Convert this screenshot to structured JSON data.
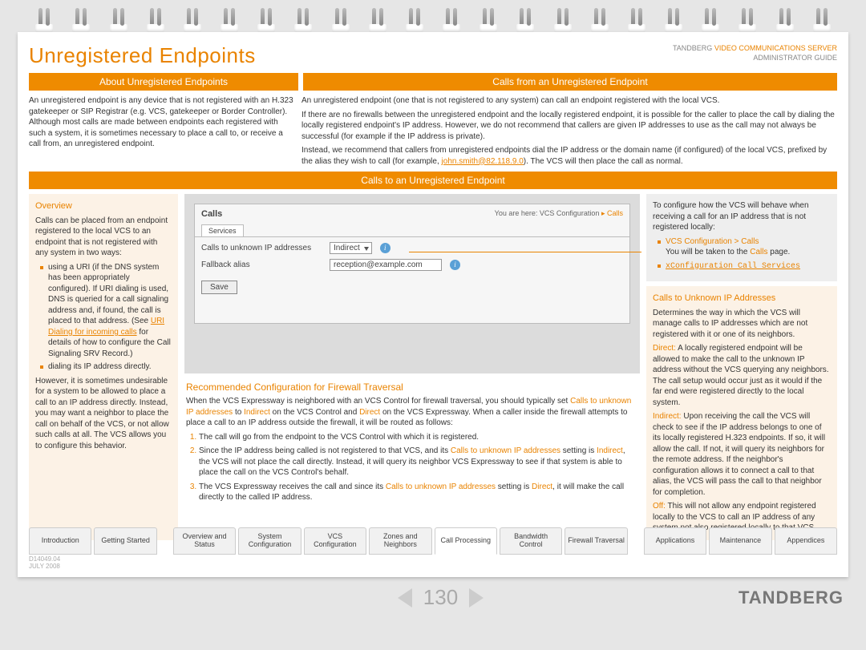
{
  "brand": {
    "company": "TANDBERG",
    "product": "VIDEO COMMUNICATIONS SERVER",
    "subtitle": "ADMINISTRATOR GUIDE",
    "logo": "TANDBERG"
  },
  "pageTitle": "Unregistered Endpoints",
  "bands": {
    "about": "About Unregistered Endpoints",
    "callsFrom": "Calls from an Unregistered Endpoint",
    "callsTo": "Calls to an Unregistered Endpoint"
  },
  "about": {
    "p1": "An unregistered endpoint is any device that is not registered with an H.323 gatekeeper or SIP Registrar (e.g. VCS, gatekeeper or Border Controller).   Although most calls are made between endpoints each registered with such a system, it is sometimes necessary to place a call to, or receive a call from, an unregistered endpoint."
  },
  "callsFrom": {
    "p1": "An unregistered endpoint (one that is not registered to any system) can call an endpoint registered with the local VCS.",
    "p2": "If there are no firewalls between the unregistered endpoint and the locally registered endpoint, it is possible for the caller to place the call by dialing the locally registered endpoint's IP address. However, we do not recommend that callers are given IP addresses to use as the call may not always be successful (for example if the IP address is private).",
    "p3a": "Instead, we recommend that callers from unregistered endpoints dial the IP address or the domain name (if configured) of the local VCS, prefixed by the alias they wish to call (for example, ",
    "p3link": "john.smith@82.118.9.0",
    "p3b": ").  The VCS will then place the call as normal."
  },
  "overview": {
    "title": "Overview",
    "intro": "Calls can be placed from an endpoint registered to the local VCS to an endpoint that is not registered with any system in two ways:",
    "b1a": "using a URI (if the DNS system has been appropriately configured). If URI dialing is used, DNS is queried for a call signaling address and, if found, the call is placed to that address. (See ",
    "b1link": "URI Dialing for incoming calls",
    "b1b": " for details of how to configure the Call Signaling SRV Record.)",
    "b2": "dialing its IP address directly.",
    "tail": "However, it is sometimes undesirable for a system to be allowed to place a call to an IP address directly. Instead, you may want a neighbor to place the call on behalf of the VCS, or not allow such calls at all.  The VCS allows you to configure this behavior."
  },
  "screenshot": {
    "panelTitle": "Calls",
    "crumbPrefix": "You are here: VCS Configuration",
    "crumbEnd": "Calls",
    "tab": "Services",
    "row1": {
      "label": "Calls to unknown IP addresses",
      "value": "Indirect"
    },
    "row2": {
      "label": "Fallback alias",
      "value": "reception@example.com"
    },
    "save": "Save"
  },
  "reco": {
    "title": "Recommended Configuration for Firewall Traversal",
    "p_a": "When the VCS Expressway is neighbored with an VCS Control for firewall traversal, you should typically set ",
    "p_l1": "Calls to unknown IP addresses",
    "p_b": " to ",
    "p_l2": "Indirect",
    "p_c": " on the VCS Control and ",
    "p_l3": "Direct",
    "p_d": " on the VCS Expressway. When a caller inside the firewall attempts to place a call to an IP address outside the firewall, it will be routed as follows:",
    "li1": "The call will go from the endpoint to the VCS Control with which it is registered.",
    "li2a": "Since the IP address being called is not registered to that VCS, and its ",
    "li2l1": "Calls to unknown IP addresses",
    "li2b": " setting is ",
    "li2l2": "Indirect",
    "li2c": ", the VCS will not place the call directly.  Instead, it will query its neighbor VCS Expressway to see if that system is able to place the call on the VCS Control's behalf.",
    "li3a": "The VCS Expressway receives the call and since its ",
    "li3l1": "Calls to unknown IP addresses",
    "li3b": " setting is ",
    "li3l2": "Direct",
    "li3c": ", it will make the call directly to the called IP address."
  },
  "configure": {
    "intro": "To configure how the VCS will behave when receiving a call for an IP address that is not registered locally:",
    "b1a": "VCS Configuration > Calls",
    "b1b": "You will be taken to the ",
    "b1c": "Calls",
    "b1d": " page.",
    "b2": "xConfiguration Call Services"
  },
  "ctu": {
    "title": "Calls to Unknown IP Addresses",
    "intro": "Determines the way in which the VCS will manage calls to IP addresses which are not registered with it or one of its neighbors.",
    "directLabel": "Direct:",
    "direct": " A locally registered endpoint will be allowed to make the call to the unknown IP address without the VCS querying any neighbors. The call setup would occur just as it would if the far end were registered directly to the local system.",
    "indirectLabel": "Indirect:",
    "indirect": " Upon receiving the call the VCS will check to see if the IP address belongs to one of its locally registered H.323 endpoints. If so, it will allow the call. If not, it will query its neighbors for the remote address.  If the neighbor's configuration allows it to connect a call to that alias, the VCS will pass the call to that neighbor for completion.",
    "offLabel": "Off:",
    "off": " This will not allow any endpoint registered locally to the VCS to call an IP address of any system not also registered locally to that VCS."
  },
  "tabs": [
    "Introduction",
    "Getting Started",
    "Overview and Status",
    "System Configuration",
    "VCS Configuration",
    "Zones and Neighbors",
    "Call Processing",
    "Bandwidth Control",
    "Firewall Traversal",
    "Applications",
    "Maintenance",
    "Appendices"
  ],
  "activeTab": 6,
  "doc": {
    "id": "D14049.04",
    "date": "JULY 2008"
  },
  "pageNumber": "130"
}
